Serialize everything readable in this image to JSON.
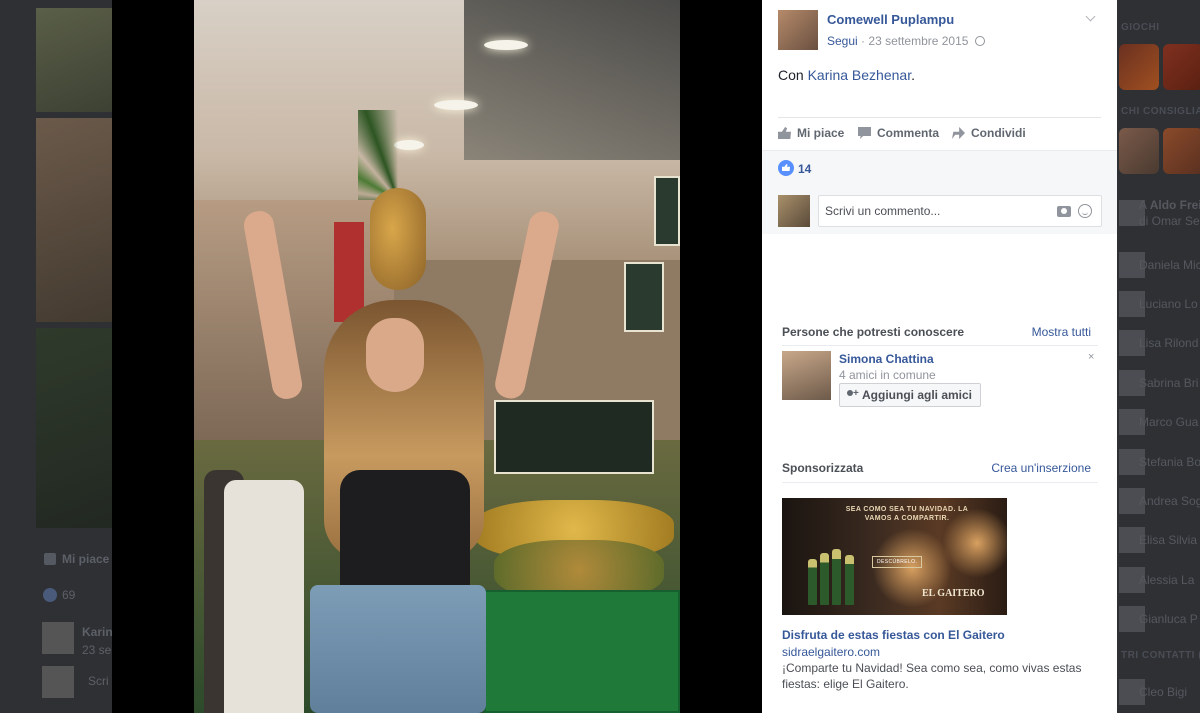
{
  "post": {
    "author": "Comewell Puplampu",
    "follow_label": "Segui",
    "date": "23 settembre 2015",
    "meta_separator": "·",
    "text_prefix": "Con ",
    "tagged_person": "Karina Bezhenar",
    "text_suffix": "."
  },
  "actions": {
    "like": "Mi piace",
    "comment": "Commenta",
    "share": "Condividi"
  },
  "reactions": {
    "count": "14"
  },
  "comment_box": {
    "placeholder": "Scrivi un commento..."
  },
  "pymk": {
    "title": "Persone che potresti conoscere",
    "see_all": "Mostra tutti",
    "person_name": "Simona Chattina",
    "mutual": "4 amici in comune",
    "add_button": "Aggiungi agli amici",
    "close": "×"
  },
  "sponsored": {
    "title": "Sponsorizzata",
    "create_ad": "Crea un'inserzione",
    "ad_headline": "SEA COMO SEA TU NAVIDAD. LA VAMOS A COMPARTIR.",
    "ad_cta": "DESCÚBRELO.",
    "ad_brand": "EL GAITERO",
    "ad_title": "Disfruta de estas fiestas con El Gaitero",
    "ad_domain": "sidraelgaitero.com",
    "ad_description": "¡Comparte tu Navidad! Sea como sea, como vivas estas fiestas: elige El Gaitero."
  },
  "background": {
    "left_like": "Mi piace",
    "left_count": "69",
    "left_comment_name": "Karin",
    "left_comment_date": "23 se",
    "left_reply": "Scri",
    "right_header_games": "GIOCHI",
    "right_header_suggested": "CHI CONSIGLIARE",
    "right_notice_prefix": "A ",
    "right_notice_name": "Aldo Frei",
    "right_notice_suffix": "di Omar Se",
    "right_contacts_header": "TRI CONTATTI (",
    "contacts": [
      "Daniela Mic",
      "Luciano Lo",
      "Lisa Rilond",
      "Sabrina Bri",
      "Marco Gua",
      "Stefania Bo",
      "Andrea Sog",
      "Elisa Silvia",
      "Alessia La",
      "Gianluca P",
      "Cleo Bigi"
    ]
  }
}
